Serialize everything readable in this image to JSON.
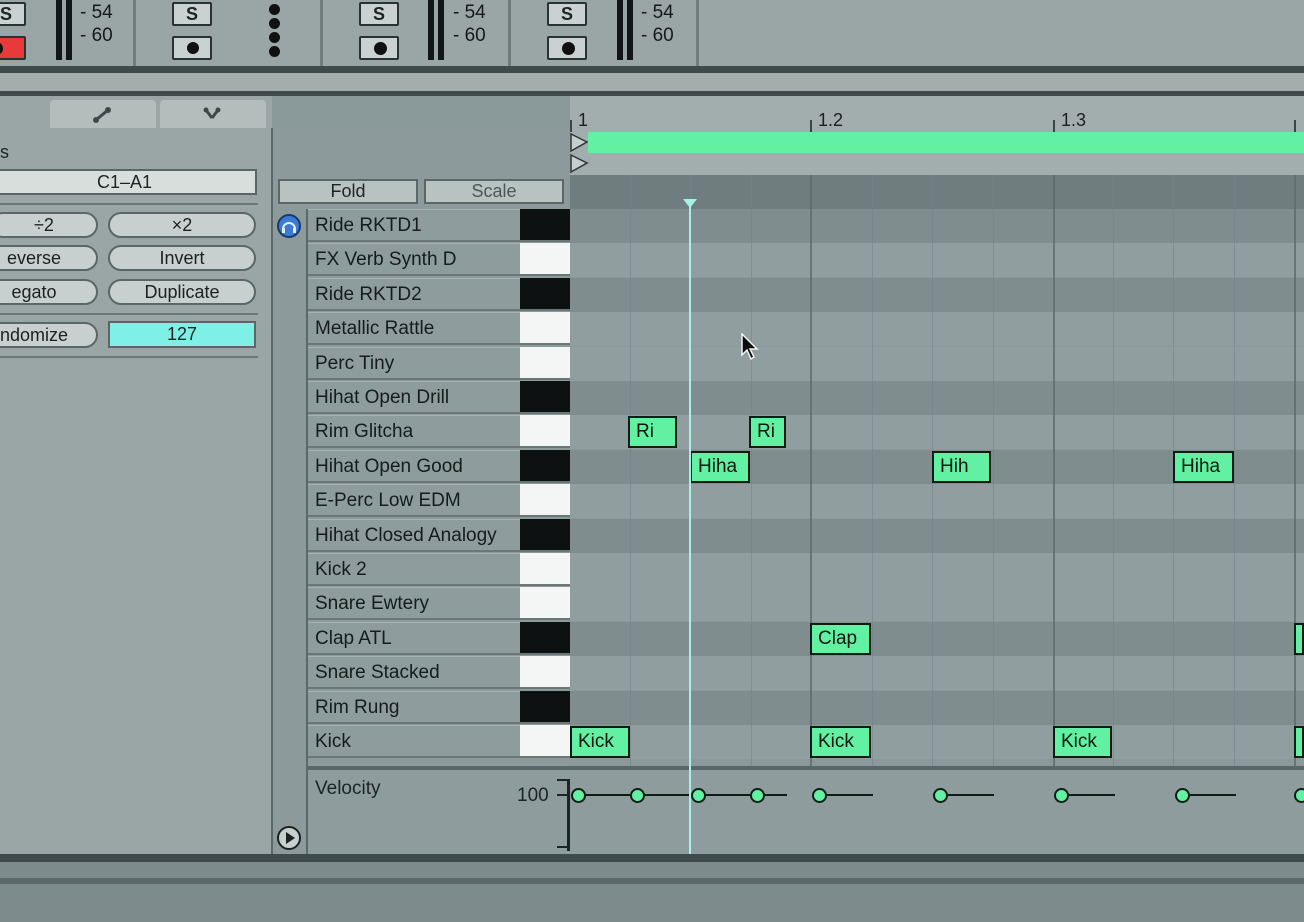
{
  "mixer": {
    "channels": [
      {
        "solo": "S",
        "meter_top": "54",
        "meter_bottom": "60",
        "record_state": "armed"
      },
      {
        "solo": "S",
        "meter_top": "",
        "meter_bottom": "",
        "record_state": "off"
      },
      {
        "solo": "S",
        "meter_top": "54",
        "meter_bottom": "60",
        "record_state": "off"
      },
      {
        "solo": "S",
        "meter_top": "54",
        "meter_bottom": "60",
        "record_state": "off"
      }
    ]
  },
  "midi_tools": {
    "partial_label": "s",
    "range": "C1–A1",
    "buttons": {
      "divide": "÷2",
      "multiply": "×2",
      "reverse": "everse",
      "invert": "Invert",
      "legato": "egato",
      "duplicate": "Duplicate",
      "randomize": "ndomize"
    },
    "randomize_value": "127"
  },
  "editor": {
    "fold_label": "Fold",
    "scale_label": "Scale",
    "ruler": [
      "1",
      "1.2",
      "1.3"
    ],
    "velocity_label": "Velocity",
    "velocity_value": "100",
    "rows": [
      {
        "name": "Ride RKTD1",
        "key": "black"
      },
      {
        "name": "FX Verb Synth D",
        "key": "white"
      },
      {
        "name": "Ride RKTD2",
        "key": "black"
      },
      {
        "name": "Metallic Rattle",
        "key": "white"
      },
      {
        "name": "Perc Tiny",
        "key": "white"
      },
      {
        "name": "Hihat Open Drill",
        "key": "black"
      },
      {
        "name": "Rim Glitcha",
        "key": "white"
      },
      {
        "name": "Hihat Open Good",
        "key": "black"
      },
      {
        "name": "E-Perc Low EDM",
        "key": "white"
      },
      {
        "name": "Hihat Closed Analogy",
        "key": "black"
      },
      {
        "name": "Kick 2",
        "key": "white"
      },
      {
        "name": "Snare Ewtery",
        "key": "white"
      },
      {
        "name": "Clap ATL",
        "key": "black"
      },
      {
        "name": "Snare Stacked",
        "key": "white"
      },
      {
        "name": "Rim Rung",
        "key": "black"
      },
      {
        "name": "Kick",
        "key": "white"
      }
    ],
    "notes": [
      {
        "label": "Ri",
        "row": 6
      },
      {
        "label": "Ri",
        "row": 6
      },
      {
        "label": "Hiha",
        "row": 7
      },
      {
        "label": "Hih",
        "row": 7
      },
      {
        "label": "Hiha",
        "row": 7
      },
      {
        "label": "Clap",
        "row": 12
      },
      {
        "label": "C",
        "row": 12
      },
      {
        "label": "Kick",
        "row": 15
      },
      {
        "label": "Kick",
        "row": 15
      },
      {
        "label": "Kick",
        "row": 15
      },
      {
        "label": "K",
        "row": 15
      }
    ]
  },
  "colors": {
    "note": "#62f0a2",
    "playhead": "#a8f0e4",
    "arm": "#e83a3a",
    "randomize_field": "#7ef0e6",
    "headphone_button": "#3b7bd8"
  }
}
